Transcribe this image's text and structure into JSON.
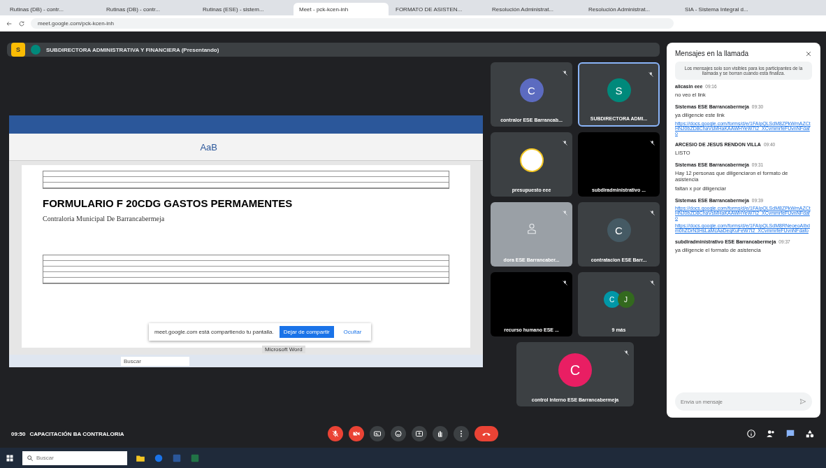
{
  "browser": {
    "tabs": [
      {
        "title": "Rutinas (DB) - contr...",
        "selected": false
      },
      {
        "title": "Rutinas (DB) - contr...",
        "selected": false
      },
      {
        "title": "Rutinas (ESE) - sistem...",
        "selected": false
      },
      {
        "title": "Meet - pck-kcen-inh",
        "selected": true
      },
      {
        "title": "FORMATO DE ASISTEN...",
        "selected": false
      },
      {
        "title": "Resolución Administrat...",
        "selected": false
      },
      {
        "title": "Resolución Administrat...",
        "selected": false
      },
      {
        "title": "SIA - Sistema Integral d...",
        "selected": false
      }
    ],
    "url": "meet.google.com/pck-kcen-inh"
  },
  "meet": {
    "presenter": {
      "initial": "S",
      "label": "SUBDIRECTORA ADMINISTRATIVA Y FINANCIERA (Presentando)"
    },
    "shared_screen": {
      "style_sample": "AaB",
      "heading": "FORMULARIO F 20CDG GASTOS PERMAMENTES",
      "subheading": "Contraloria Municipal De Barrancabermeja",
      "share_bar": {
        "message": "meet.google.com está compartiendo tu pantalla.",
        "stop_button": "Dejar de compartir",
        "hide_button": "Ocultar",
        "app_label": "Microsoft Word"
      },
      "taskbar_search": "Buscar"
    },
    "tiles": [
      {
        "name": "contralor ESE Barrancab...",
        "kind": "avatar",
        "initial": "C",
        "color": "#5c6bc0",
        "selected": false
      },
      {
        "name": "SUBDIRECTORA ADMI...",
        "kind": "avatar",
        "initial": "S",
        "color": "#00897b",
        "selected": true
      },
      {
        "name": "presupuesto eee",
        "kind": "logo",
        "selected": false
      },
      {
        "name": "subdiradministrativo ...",
        "kind": "video",
        "selected": false
      },
      {
        "name": "dora ESE Barrancaber...",
        "kind": "dim",
        "selected": false
      },
      {
        "name": "contratacion ESE Barr...",
        "kind": "avatar",
        "initial": "C",
        "color": "#455a64",
        "selected": false
      },
      {
        "name": "recurso humano ESE ...",
        "kind": "video",
        "selected": false
      },
      {
        "name": "9 más",
        "kind": "group",
        "avatars": [
          {
            "initial": "C",
            "color": "#0097a7"
          },
          {
            "initial": "J",
            "color": "#33691e"
          }
        ],
        "selected": false
      },
      {
        "name": "control interno ESE Barrancabermeja",
        "kind": "avatar",
        "initial": "C",
        "color": "#e91e63",
        "selected": false
      }
    ],
    "chat": {
      "title": "Mensajes en la llamada",
      "notice": "Los mensajes solo son visibles para los participantes de la llamada y se borran cuando esta finaliza.",
      "messages": [
        {
          "sender": "alicasin eee",
          "time": "09:16",
          "lines": [
            {
              "kind": "text",
              "text": "no veo el link"
            }
          ]
        },
        {
          "sender": "Sistemas ESE Barrancabermeja",
          "time": "09:30",
          "lines": [
            {
              "kind": "text",
              "text": "ya diligencie este link"
            },
            {
              "kind": "link",
              "text": "https://docs.google.com/forms/d/e/1FAIpQLSdM8ZPkWmAZCtHNJ0bZD8ChaVsMHaKAAWHYeW7I2_XCvmmrfeFUvnNFdafo"
            }
          ]
        },
        {
          "sender": "ARCESIO DE JESUS RENDON VILLA",
          "time": "09:40",
          "lines": [
            {
              "kind": "text",
              "text": "LISTO"
            }
          ]
        },
        {
          "sender": "Sistemas ESE Barrancabermeja",
          "time": "09:31",
          "lines": [
            {
              "kind": "text",
              "text": "Hay 12 personas que diligenciaron el formato de asistencia"
            },
            {
              "kind": "text",
              "text": "faltan x por diligenciar"
            }
          ]
        },
        {
          "sender": "Sistemas ESE Barrancabermeja",
          "time": "09:39",
          "lines": [
            {
              "kind": "link",
              "text": "https://docs.google.com/forms/d/e/1FAIpQLSdM8ZPkWmAZCtHNJ0bZD8ChaVsMHaKAAWHYeW7I2_XCvmmrfeFUvnNFdafo"
            },
            {
              "kind": "link",
              "text": "https://docs.google.com/forms/d/e/1FAIpQLSdM8RNeoeoAIbdm0hZDrN3HsLaMcAaDeqKuFeW7I2_XCvmmrfeFUvnNFdafo"
            }
          ]
        },
        {
          "sender": "subdiradministrativo ESE Barrancabermeja",
          "time": "09:37",
          "lines": [
            {
              "kind": "text",
              "text": "ya diligencie el formato de asistencia"
            }
          ]
        }
      ],
      "placeholder": "Envía un mensaje"
    },
    "bottom": {
      "time": "09:50",
      "meeting_name": "CAPACITACIÓN BA CONTRALORIA"
    },
    "controls": [
      {
        "kind": "mic",
        "off": true
      },
      {
        "kind": "camera",
        "off": true
      },
      {
        "kind": "captions",
        "off": false
      },
      {
        "kind": "emoji",
        "off": false
      },
      {
        "kind": "present",
        "off": false
      },
      {
        "kind": "hand",
        "off": false
      },
      {
        "kind": "more",
        "off": false
      },
      {
        "kind": "hangup"
      }
    ]
  },
  "taskbar": {
    "search_placeholder": "Buscar"
  }
}
